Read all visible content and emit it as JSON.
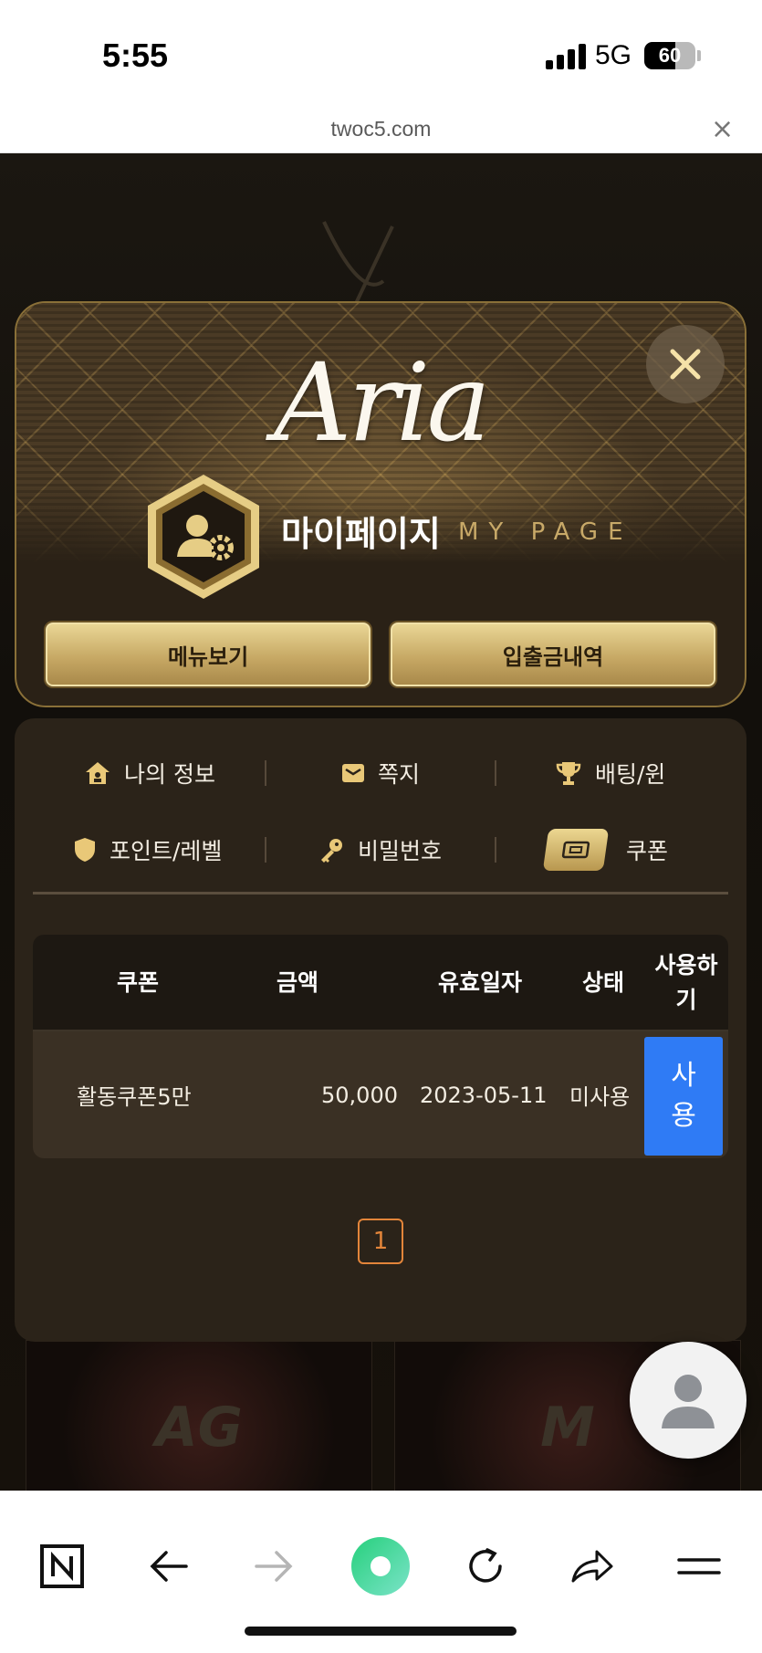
{
  "status_bar": {
    "time": "5:55",
    "network": "5G",
    "battery": "60",
    "battery_level": 0.6
  },
  "browser": {
    "url": "twoc5.com",
    "close_label": "×"
  },
  "background": {
    "thumbs": [
      "AG",
      "M"
    ]
  },
  "modal": {
    "logo": "Aria",
    "title": "마이페이지",
    "subtitle": "MY PAGE",
    "buttons": {
      "menu": "메뉴보기",
      "history": "입출금내역"
    }
  },
  "menu": {
    "my_info": "나의 정보",
    "messages": "쪽지",
    "betting": "배팅/윈",
    "points": "포인트/레벨",
    "password": "비밀번호",
    "coupon": "쿠폰"
  },
  "coupon_table": {
    "headers": [
      "쿠폰",
      "금액",
      "유효일자",
      "상태",
      "사용하\n기"
    ],
    "rows": [
      {
        "name": "활동쿠폰5만",
        "amount": "50,000",
        "expiry": "2023-05-11",
        "status": "미사용",
        "action": "사\n용"
      }
    ]
  },
  "pagination": {
    "current": "1"
  },
  "colors": {
    "accent_gold": "#c7a965",
    "use_button": "#2f7bf5",
    "page_active": "#e3853a"
  },
  "icons": [
    "home-icon",
    "mail-icon",
    "trophy-icon",
    "shield-icon",
    "key-icon",
    "ticket-icon",
    "user-gear-icon",
    "close-icon",
    "person-icon",
    "naver-icon",
    "back-icon",
    "forward-icon",
    "green-dot-icon",
    "refresh-icon",
    "share-icon",
    "menu-icon"
  ]
}
